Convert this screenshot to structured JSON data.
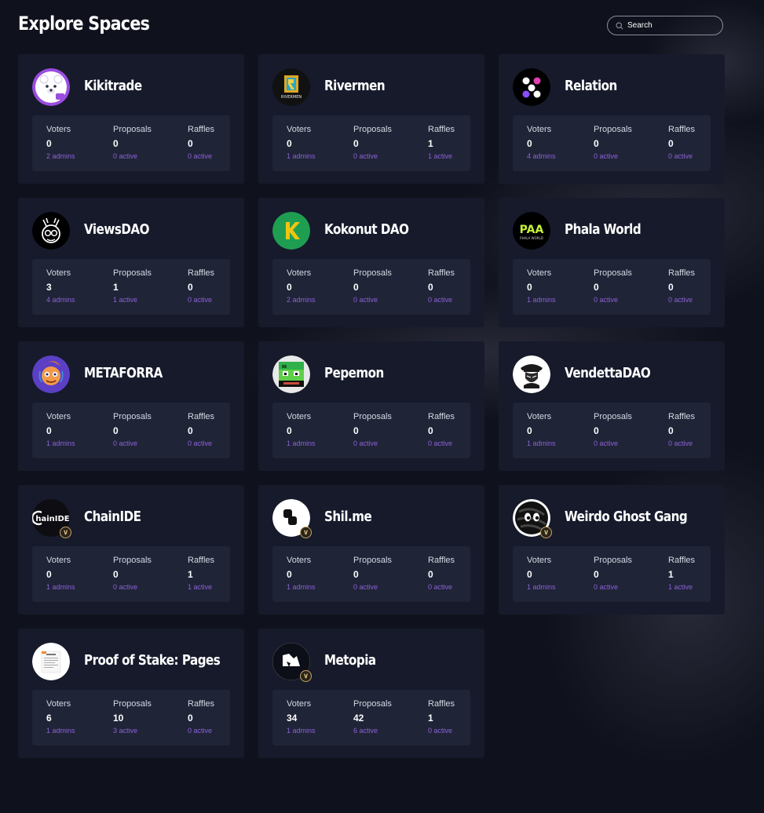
{
  "page_title": "Explore Spaces",
  "search": {
    "placeholder": "Search"
  },
  "colors": {
    "background": "#0f111c",
    "card": "#161a2b",
    "stats_panel": "#1f2437",
    "accent": "#8c62d6",
    "verified_badge": "#c9a46a"
  },
  "stat_labels": {
    "voters": "Voters",
    "proposals": "Proposals",
    "raffles": "Raffles"
  },
  "spaces": [
    {
      "name": "Kikitrade",
      "icon": "polar-bear-logo",
      "verified": false,
      "voters": "0",
      "admins": "2 admins",
      "proposals": "0",
      "proposals_active": "0 active",
      "raffles": "0",
      "raffles_active": "0 active"
    },
    {
      "name": "Rivermen",
      "icon": "rivermen-logo",
      "verified": false,
      "voters": "0",
      "admins": "1 admins",
      "proposals": "0",
      "proposals_active": "0 active",
      "raffles": "1",
      "raffles_active": "1 active"
    },
    {
      "name": "Relation",
      "icon": "relation-logo",
      "verified": false,
      "voters": "0",
      "admins": "4 admins",
      "proposals": "0",
      "proposals_active": "0 active",
      "raffles": "0",
      "raffles_active": "0 active"
    },
    {
      "name": "ViewsDAO",
      "icon": "viewsdao-logo",
      "verified": false,
      "voters": "3",
      "admins": "4 admins",
      "proposals": "1",
      "proposals_active": "1 active",
      "raffles": "0",
      "raffles_active": "0 active"
    },
    {
      "name": "Kokonut DAO",
      "icon": "kokonut-logo",
      "verified": false,
      "voters": "0",
      "admins": "2 admins",
      "proposals": "0",
      "proposals_active": "0 active",
      "raffles": "0",
      "raffles_active": "0 active"
    },
    {
      "name": "Phala World",
      "icon": "phala-world-logo",
      "verified": false,
      "voters": "0",
      "admins": "1 admins",
      "proposals": "0",
      "proposals_active": "0 active",
      "raffles": "0",
      "raffles_active": "0 active"
    },
    {
      "name": "METAFORRA",
      "icon": "metaforra-logo",
      "verified": false,
      "voters": "0",
      "admins": "1 admins",
      "proposals": "0",
      "proposals_active": "0 active",
      "raffles": "0",
      "raffles_active": "0 active"
    },
    {
      "name": "Pepemon",
      "icon": "pepemon-logo",
      "verified": false,
      "voters": "0",
      "admins": "1 admins",
      "proposals": "0",
      "proposals_active": "0 active",
      "raffles": "0",
      "raffles_active": "0 active"
    },
    {
      "name": "VendettaDAO",
      "icon": "vendetta-logo",
      "verified": false,
      "voters": "0",
      "admins": "1 admins",
      "proposals": "0",
      "proposals_active": "0 active",
      "raffles": "0",
      "raffles_active": "0 active"
    },
    {
      "name": "ChainIDE",
      "icon": "chainide-logo",
      "verified": true,
      "voters": "0",
      "admins": "1 admins",
      "proposals": "0",
      "proposals_active": "0 active",
      "raffles": "1",
      "raffles_active": "1 active"
    },
    {
      "name": "Shil.me",
      "icon": "shilme-logo",
      "verified": true,
      "voters": "0",
      "admins": "1 admins",
      "proposals": "0",
      "proposals_active": "0 active",
      "raffles": "0",
      "raffles_active": "0 active"
    },
    {
      "name": "Weirdo Ghost Gang",
      "icon": "weirdo-ghost-logo",
      "verified": true,
      "voters": "0",
      "admins": "1 admins",
      "proposals": "0",
      "proposals_active": "0 active",
      "raffles": "1",
      "raffles_active": "1 active"
    },
    {
      "name": "Proof of Stake: Pages",
      "icon": "proof-of-stake-logo",
      "verified": false,
      "voters": "6",
      "admins": "1 admins",
      "proposals": "10",
      "proposals_active": "3 active",
      "raffles": "0",
      "raffles_active": "0 active"
    },
    {
      "name": "Metopia",
      "icon": "metopia-logo",
      "verified": true,
      "voters": "34",
      "admins": "1 admins",
      "proposals": "42",
      "proposals_active": "6 active",
      "raffles": "1",
      "raffles_active": "0 active"
    }
  ]
}
